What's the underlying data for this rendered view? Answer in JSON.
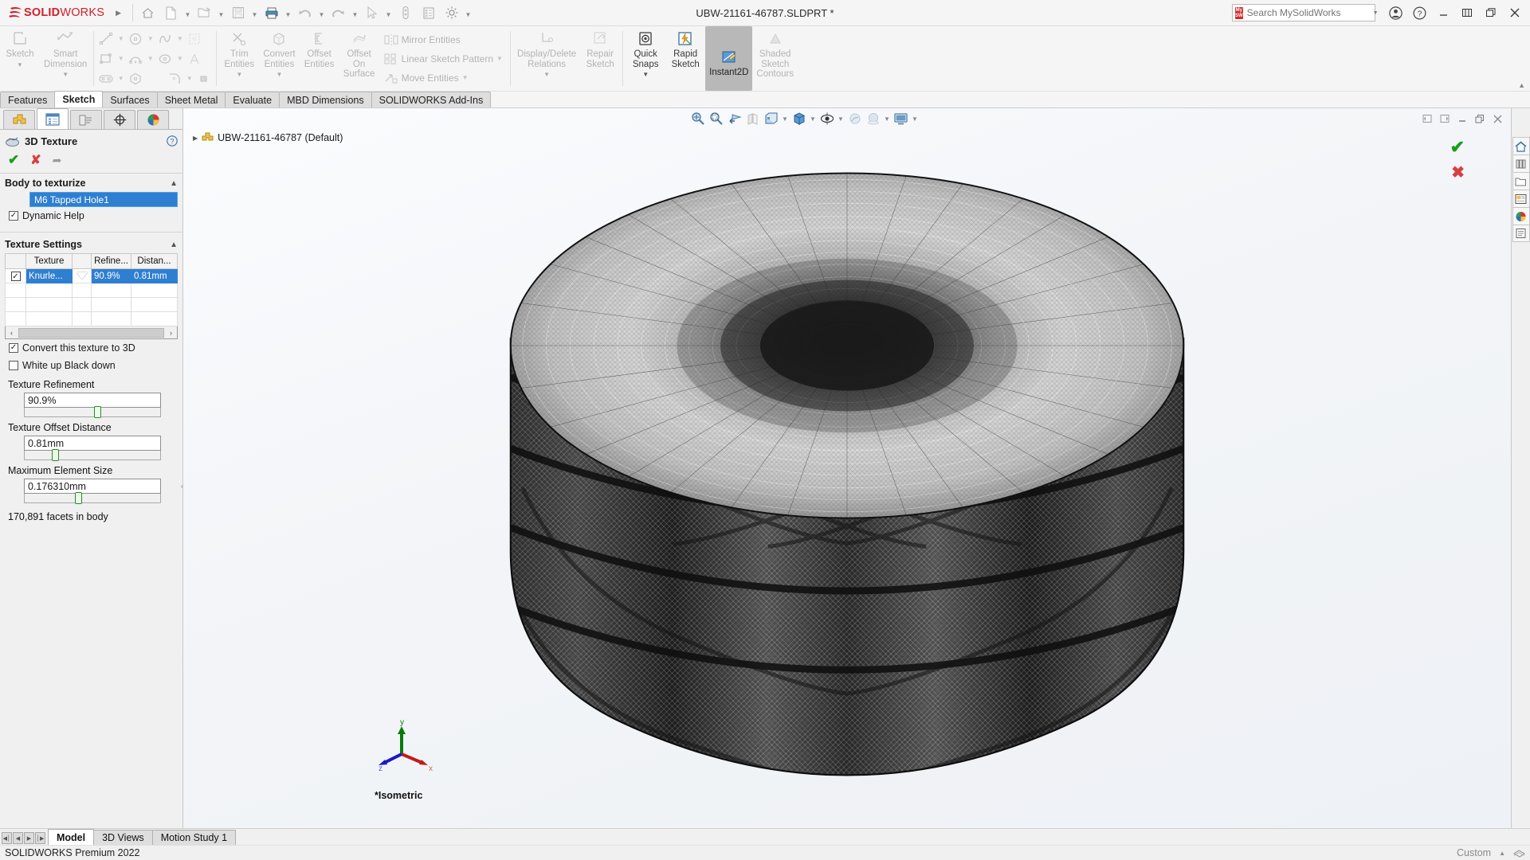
{
  "titlebar": {
    "brand_ds": "Ą2S",
    "brand_solid": "SOLID",
    "brand_works": "WORKS",
    "document_title": "UBW-21161-46787.SLDPRT *",
    "search_placeholder": "Search MySolidWorks",
    "search_value": "",
    "mysw_badge_line1": "My",
    "mysw_badge_line2": "SW",
    "quick_access": [
      {
        "name": "home-icon",
        "label": "Home"
      },
      {
        "name": "new-document-icon",
        "label": "New"
      },
      {
        "name": "open-document-icon",
        "label": "Open"
      },
      {
        "name": "save-icon",
        "label": "Save"
      },
      {
        "name": "print-icon",
        "label": "Print"
      },
      {
        "name": "undo-icon",
        "label": "Undo"
      },
      {
        "name": "redo-icon",
        "label": "Redo"
      },
      {
        "name": "select-arrow-icon",
        "label": "Select"
      },
      {
        "name": "measure-icon",
        "label": "Measure"
      },
      {
        "name": "rebuild-icon",
        "label": "Rebuild"
      },
      {
        "name": "options-gear-icon",
        "label": "Options"
      }
    ],
    "window_controls": [
      {
        "name": "minimize-button",
        "glyph": "—"
      },
      {
        "name": "restore-button",
        "glyph": "⊞"
      },
      {
        "name": "maximize-button",
        "glyph": "❐"
      },
      {
        "name": "close-button",
        "glyph": "✕"
      }
    ],
    "account_label": "User Account",
    "help_label": "Help"
  },
  "ribbon": {
    "groups": [
      {
        "buttons": [
          {
            "label": "Sketch",
            "name": "sketch-button",
            "enabled": false,
            "dropdown": true
          },
          {
            "label": "Smart\nDimension",
            "name": "smart-dimension-button",
            "enabled": false,
            "dropdown": true
          }
        ]
      },
      {
        "buttons": [
          {
            "label": "Trim\nEntities",
            "name": "trim-entities-button",
            "enabled": false,
            "dropdown": true
          },
          {
            "label": "Convert\nEntities",
            "name": "convert-entities-button",
            "enabled": false,
            "dropdown": true
          },
          {
            "label": "Offset\nEntities",
            "name": "offset-entities-button",
            "enabled": false,
            "dropdown": false
          },
          {
            "label": "Offset\nOn\nSurface",
            "name": "offset-on-surface-button",
            "enabled": false,
            "dropdown": false
          }
        ]
      },
      {
        "list": [
          {
            "label": "Mirror Entities",
            "name": "mirror-entities-item",
            "dropdown": false
          },
          {
            "label": "Linear Sketch Pattern",
            "name": "linear-sketch-pattern-item",
            "dropdown": true
          },
          {
            "label": "Move Entities",
            "name": "move-entities-item",
            "dropdown": true
          }
        ]
      },
      {
        "buttons": [
          {
            "label": "Display/Delete\nRelations",
            "name": "display-delete-relations-button",
            "enabled": false,
            "dropdown": true
          },
          {
            "label": "Repair\nSketch",
            "name": "repair-sketch-button",
            "enabled": false,
            "dropdown": false
          }
        ]
      },
      {
        "buttons": [
          {
            "label": "Quick\nSnaps",
            "name": "quick-snaps-button",
            "enabled": true,
            "dropdown": true
          },
          {
            "label": "Rapid\nSketch",
            "name": "rapid-sketch-button",
            "enabled": true,
            "dropdown": false
          },
          {
            "label": "Instant2D",
            "name": "instant2d-button",
            "enabled": true,
            "active": true,
            "dropdown": false
          },
          {
            "label": "Shaded\nSketch\nContours",
            "name": "shaded-sketch-contours-button",
            "enabled": false,
            "dropdown": false
          }
        ]
      }
    ]
  },
  "tabs": [
    {
      "label": "Features",
      "name": "tab-features",
      "active": false
    },
    {
      "label": "Sketch",
      "name": "tab-sketch",
      "active": true
    },
    {
      "label": "Surfaces",
      "name": "tab-surfaces",
      "active": false
    },
    {
      "label": "Sheet Metal",
      "name": "tab-sheet-metal",
      "active": false
    },
    {
      "label": "Evaluate",
      "name": "tab-evaluate",
      "active": false
    },
    {
      "label": "MBD Dimensions",
      "name": "tab-mbd-dimensions",
      "active": false
    },
    {
      "label": "SOLIDWORKS Add-Ins",
      "name": "tab-solidworks-add-ins",
      "active": false
    }
  ],
  "property_manager": {
    "tabs": [
      {
        "name": "feature-manager-tab",
        "icon": "feature-tree-icon",
        "active": false
      },
      {
        "name": "property-manager-tab",
        "icon": "property-manager-icon",
        "active": true
      },
      {
        "name": "configuration-manager-tab",
        "icon": "configuration-icon",
        "active": false
      },
      {
        "name": "dimxpert-manager-tab",
        "icon": "dimxpert-icon",
        "active": false
      },
      {
        "name": "display-manager-tab",
        "icon": "appearance-sphere-icon",
        "active": false
      }
    ],
    "title": "3D Texture",
    "help_glyph": "?",
    "accept_glyph": "✔",
    "cancel_glyph": "✘",
    "pin_glyph": "⚐",
    "section_body": {
      "title": "Body to texturize",
      "selection": "M6 Tapped Hole1",
      "dynamic_help_label": "Dynamic Help",
      "dynamic_help_checked": true
    },
    "section_texture": {
      "title": "Texture Settings",
      "columns": [
        "",
        "Texture",
        "",
        "Refine...",
        "Distan..."
      ],
      "rows": [
        {
          "checked": true,
          "texture": "Knurle...",
          "refinement": "90.9%",
          "distance": "0.81mm",
          "selected": true
        }
      ],
      "empty_rows": 3,
      "scroll_left_glyph": "‹",
      "scroll_right_glyph": "›"
    },
    "convert_label": "Convert this texture to 3D",
    "convert_checked": true,
    "white_black_label": "White up Black down",
    "white_black_checked": false,
    "fields": [
      {
        "label": "Texture Refinement",
        "name": "texture-refinement",
        "value": "90.9%",
        "slider_pct": 51
      },
      {
        "label": "Texture Offset Distance",
        "name": "texture-offset-distance",
        "value": "0.81mm",
        "slider_pct": 20
      },
      {
        "label": "Maximum Element Size",
        "name": "maximum-element-size",
        "value": "0.176310mm",
        "slider_pct": 37
      }
    ],
    "facets_text": "170,891 facets in body"
  },
  "graphics": {
    "view_toolbar": [
      {
        "name": "zoom-to-fit-icon",
        "caret": false
      },
      {
        "name": "zoom-to-area-icon",
        "caret": false
      },
      {
        "name": "previous-view-icon",
        "caret": false
      },
      {
        "name": "section-view-icon",
        "caret": false
      },
      {
        "name": "view-orientation-icon",
        "caret": true
      },
      {
        "name": "display-style-icon",
        "caret": true
      },
      {
        "name": "hide-show-items-icon",
        "caret": true
      },
      {
        "name": "edit-appearance-icon",
        "caret": false
      },
      {
        "name": "apply-scene-icon",
        "caret": true
      },
      {
        "name": "view-settings-icon",
        "caret": true
      }
    ],
    "window_controls": [
      {
        "name": "tile-left-button",
        "glyph": "◁"
      },
      {
        "name": "tile-right-button",
        "glyph": "▷"
      },
      {
        "name": "minimize-doc-button",
        "glyph": "—"
      },
      {
        "name": "restore-doc-button",
        "glyph": "❐"
      },
      {
        "name": "close-doc-button",
        "glyph": "✕"
      }
    ],
    "tree_root": "UBW-21161-46787 (Default)",
    "tree_arrow": "▶",
    "confirm_check": "✔",
    "confirm_cancel": "✖",
    "view_label": "*Isometric",
    "triad": {
      "x": "x",
      "y": "y",
      "z": "z"
    }
  },
  "task_pane": [
    {
      "name": "solidworks-resources-home-icon"
    },
    {
      "name": "design-library-icon"
    },
    {
      "name": "file-explorer-icon"
    },
    {
      "name": "view-palette-icon"
    },
    {
      "name": "appearances-scenes-icon"
    },
    {
      "name": "custom-properties-icon"
    }
  ],
  "bottom": {
    "nav_glyphs": [
      "◀┃",
      "◀",
      "▶",
      "┃▶"
    ],
    "tabs": [
      {
        "label": "Model",
        "name": "bottom-tab-model",
        "active": true
      },
      {
        "label": "3D Views",
        "name": "bottom-tab-3d-views",
        "active": false
      },
      {
        "label": "Motion Study 1",
        "name": "bottom-tab-motion-study-1",
        "active": false
      }
    ]
  },
  "status": {
    "left": "SOLIDWORKS Premium 2022",
    "right_label": "Custom",
    "right_caret": "▲"
  },
  "colors": {
    "brand_red": "#d11f2a",
    "selection_blue": "#2f7fd1",
    "accept_green": "#1a9e1a",
    "cancel_red": "#d64040",
    "ribbon_bg": "#f5f5f5",
    "active_tab_bg": "#ffffff"
  }
}
